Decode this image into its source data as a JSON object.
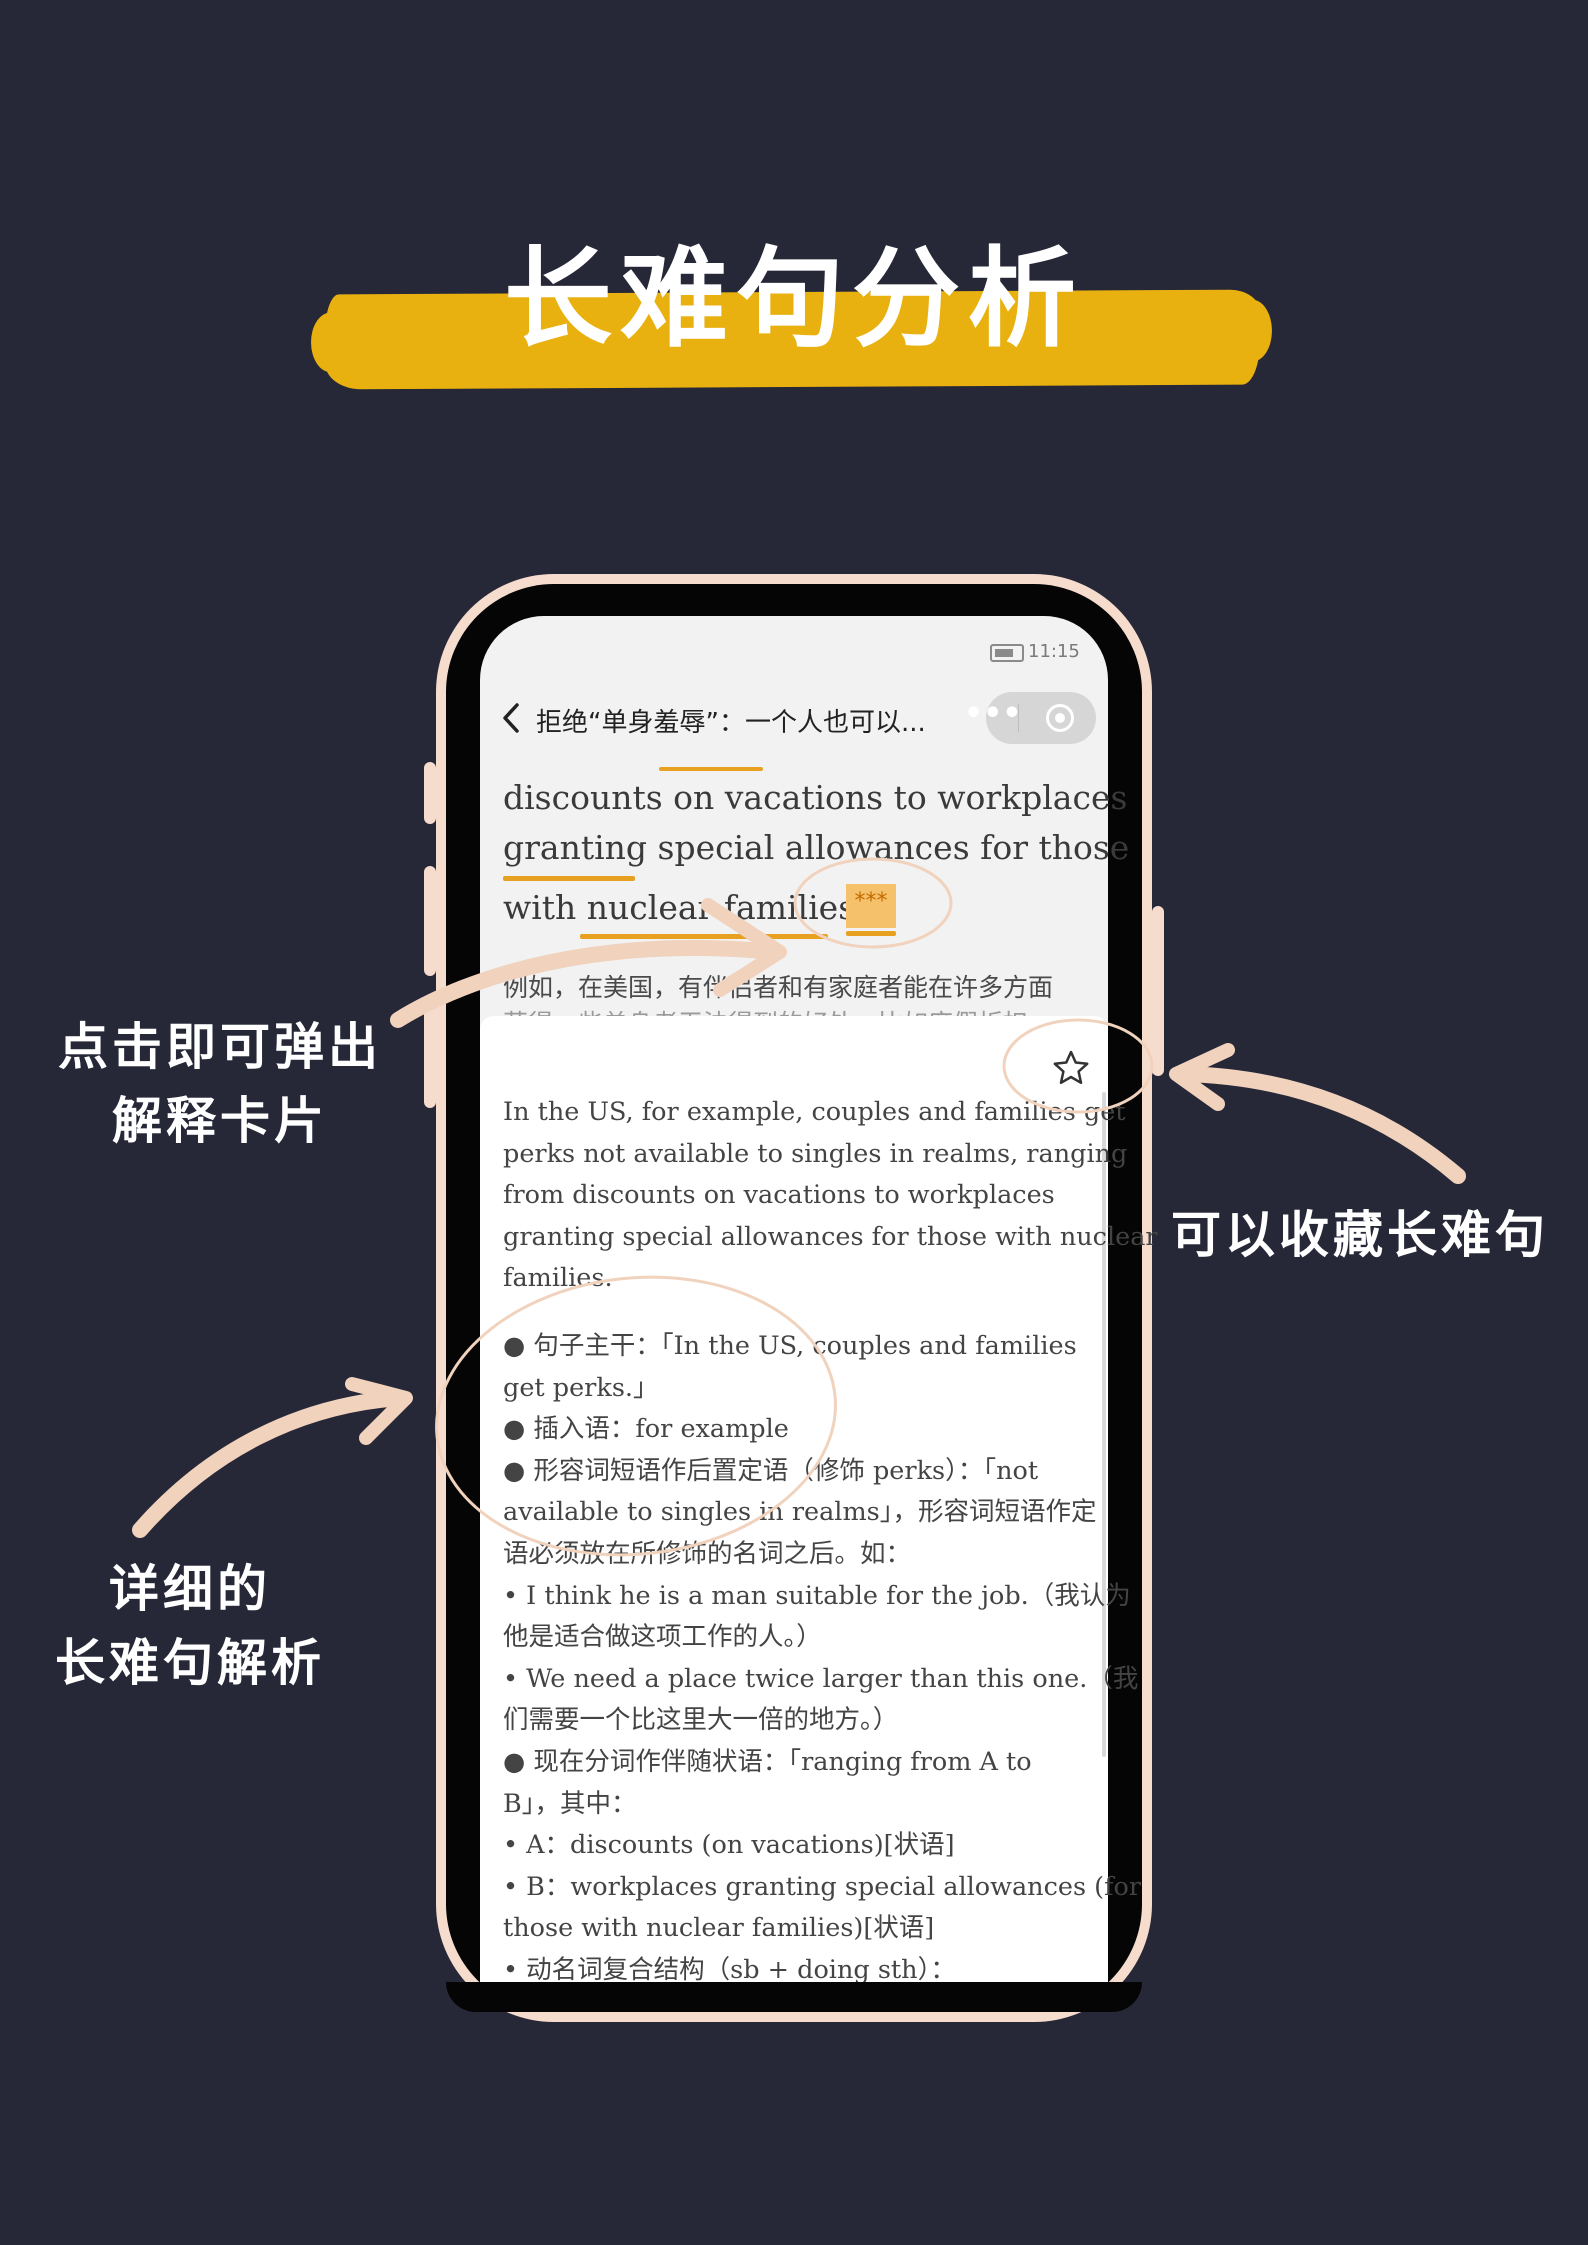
{
  "title": "长难句分析",
  "callouts": {
    "left_top": [
      "点击即可弹出",
      "解释卡片"
    ],
    "right": "可以收藏长难句",
    "left_bottom": [
      "详细的",
      "长难句解析"
    ]
  },
  "status_bar": {
    "time": "11:15"
  },
  "nav": {
    "back_icon": "chevron-left-icon",
    "title": "拒绝“单身羞辱”：一个人也可以...",
    "more_icon": "more-dots-icon",
    "close_icon": "target-icon"
  },
  "article": {
    "lines": [
      "discounts on vacations to workplaces",
      "granting special allowances for those",
      "with nuclear families."
    ],
    "marker": "***",
    "translation": [
      "例如，在美国，有伴侣者和有家庭者能在许多方面",
      "获得一些单身者无法得到的好处，比如度假折扣"
    ]
  },
  "card": {
    "favorite_icon": "star-icon",
    "lines": [
      "In the US, for example, couples and families get",
      "perks not available to singles in realms, ranging",
      "from discounts on vacations to workplaces",
      "granting special allowances for those with nuclear",
      "families.",
      "",
      "● 句子主干：「In the US, couples and families",
      "get perks.」",
      "● 插入语：for example",
      "● 形容词短语作后置定语（修饰 perks）：「not",
      "available to singles in realms」，形容词短语作定",
      "语必须放在所修饰的名词之后。如：",
      "• I think he is a man suitable for the job.（我认为",
      "他是适合做这项工作的人。）",
      "• We need a place twice larger than this one.（我",
      "们需要一个比这里大一倍的地方。）",
      "● 现在分词作伴随状语：「ranging from A to",
      "B」，其中：",
      "• A：discounts (on vacations)[状语]",
      "• B：workplaces granting special allowances (for",
      "those with nuclear families)[状语]",
      "• 动名词复合结构（sb + doing sth）："
    ]
  },
  "colors": {
    "background": "#262838",
    "accent": "#e8b10f",
    "underline": "#e8a020",
    "annotation": "#f0d2bd"
  }
}
